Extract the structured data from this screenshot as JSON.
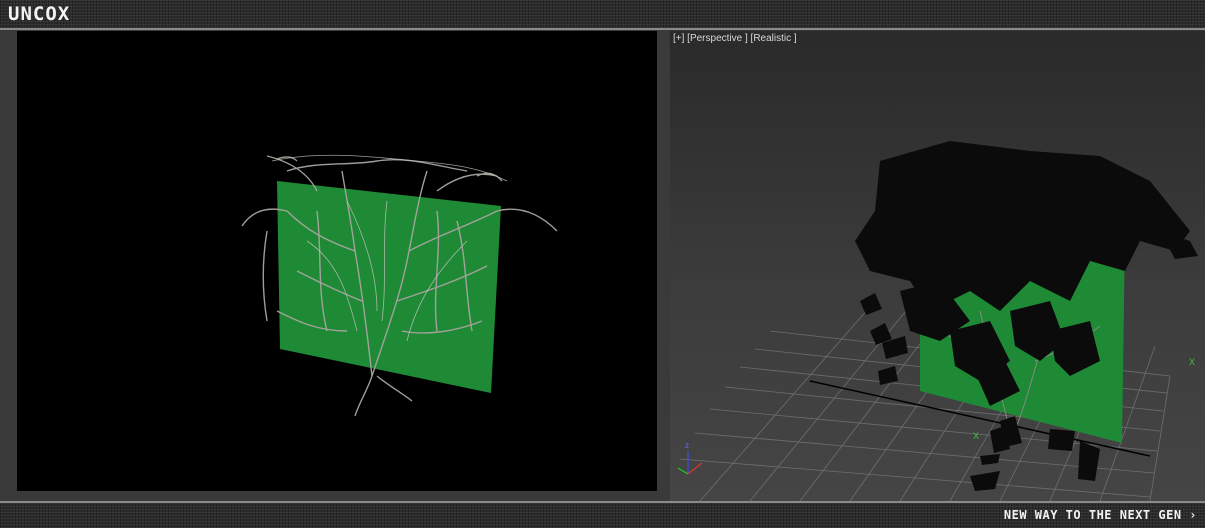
{
  "header": {
    "logo": "UNCOX"
  },
  "viewport_right": {
    "label": "[+] [Perspective ] [Realistic ]",
    "axis_z": "z",
    "axis_x": "x",
    "axis_label_grid": "X"
  },
  "footer": {
    "tagline": "NEW WAY TO THE NEXT GEN ›"
  },
  "colors": {
    "wall_green": "#1f8a36",
    "vine_gray": "#a9a5a0",
    "leaf_black": "#0b0b0b"
  }
}
